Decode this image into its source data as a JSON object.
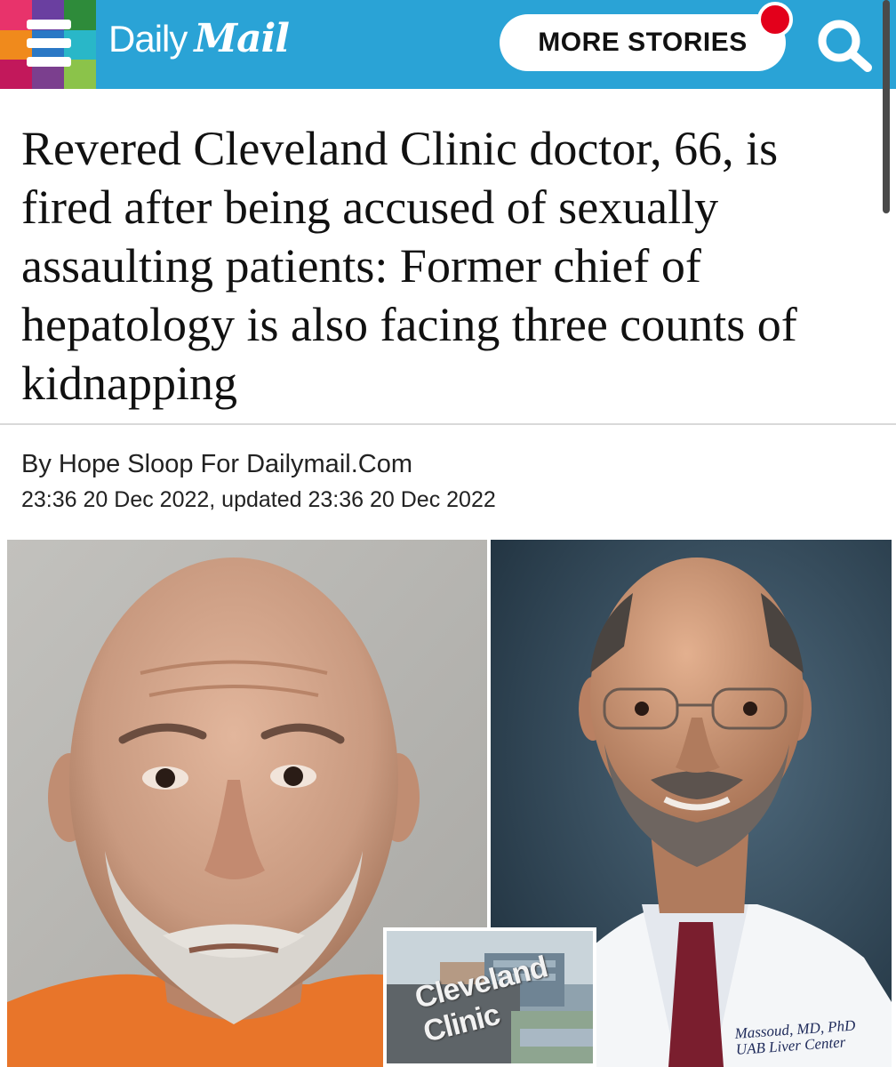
{
  "header": {
    "brand_daily": "Daily",
    "brand_mail": "Mail",
    "more_stories_label": "MORE STORIES"
  },
  "article": {
    "headline": "Revered Cleveland Clinic doctor, 66, is fired after being accused of sexually assaulting patients: Former chief of hepatology is also facing three counts of kidnapping",
    "byline": "By Hope Sloop For Dailymail.Com",
    "dateline": "23:36 20 Dec 2022, updated 23:36 20 Dec 2022"
  },
  "images": {
    "inset_sign_text": "Cleveland Clinic",
    "coat_embroidery_line1": "Massoud, MD, PhD",
    "coat_embroidery_line2": "UAB Liver Center"
  },
  "colors": {
    "header_bg": "#2aa3d6",
    "notification_dot": "#e3001b",
    "button_bg": "#ffffff",
    "text": "#111111"
  },
  "icons": [
    "menu-icon",
    "search-icon"
  ]
}
